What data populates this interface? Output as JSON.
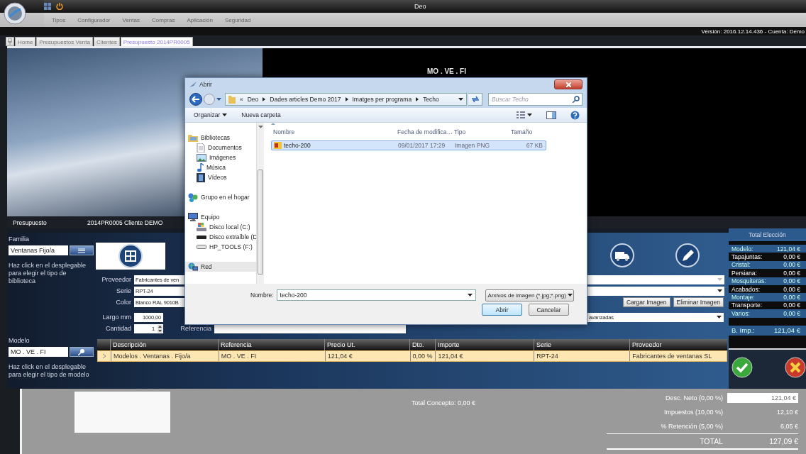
{
  "window": {
    "title": "Deo"
  },
  "menu": [
    "Tipos",
    "Configurador",
    "Ventas",
    "Compras",
    "Aplicación",
    "Seguridad"
  ],
  "version": "Versión: 2016.12.14.436 - Cuenta: Demo",
  "tabs": [
    {
      "label": "Home",
      "selected": false
    },
    {
      "label": "Presupuestos Venta",
      "selected": false
    },
    {
      "label": "Clientes",
      "selected": false
    },
    {
      "label": "Presupuesto 2014PR0005",
      "selected": true
    }
  ],
  "preview": {
    "model_code": "MO . VE . FI"
  },
  "budget": {
    "label": "Presupuesto",
    "value": "2014PR0005 Cliente DEMO"
  },
  "family": {
    "label": "Familia",
    "value": "Ventanas Fijo/a",
    "hint": "Haz click en el desplegable para elegir el tipo de biblioteca"
  },
  "model": {
    "label": "Modelo",
    "value": "MO . VE . FI",
    "hint": "Haz click en el desplegable para elegir el tipo de modelo"
  },
  "form": {
    "supplier": {
      "label": "Proveedor",
      "value": "Fabricantes de ven"
    },
    "series": {
      "label": "Serie",
      "value": "RPT-24"
    },
    "color": {
      "label": "Color",
      "value": "Blanco RAL 9010B"
    },
    "length": {
      "label": "Largo mm",
      "value": "1000,00"
    },
    "quantity": {
      "label": "Cantidad",
      "value": "1"
    },
    "reference": {
      "label": "Referencia"
    }
  },
  "image_buttons": [
    "Cargar Imagen",
    "Eliminar Imagen"
  ],
  "options_dropdown": {
    "value": "avanzadas"
  },
  "table": {
    "columns": [
      "Descripción",
      "Referencia",
      "Precio Ut.",
      "Dto.",
      "Importe",
      "Serie",
      "Proveedor"
    ],
    "rows": [
      {
        "selected": true,
        "cells": [
          "Modelos . Ventanas . Fijo/a",
          "MO . VE . FI",
          "121,04 €",
          "0,00 %",
          "121,04 €",
          "RPT-24",
          "Fabricantes de ventanas SL"
        ]
      }
    ]
  },
  "totals": {
    "title": "Total Elección",
    "rows": [
      {
        "label": "Modelo:",
        "value": "121,04 €"
      },
      {
        "label": "Tapajuntas:",
        "value": "0,00 €"
      },
      {
        "label": "Cristal:",
        "value": "0,00 €"
      },
      {
        "label": "Persiana:",
        "value": "0,00 €"
      },
      {
        "label": "Mosquiteras:",
        "value": "0,00 €"
      },
      {
        "label": "Acabados:",
        "value": "0,00 €"
      },
      {
        "label": "Montaje:",
        "value": "0,00 €"
      },
      {
        "label": "Transporte:",
        "value": "0,00 €"
      },
      {
        "label": "Varios:",
        "value": "0,00 €"
      }
    ],
    "base": {
      "label": "B. Imp.:",
      "value": "121,04 €"
    }
  },
  "summary": {
    "concept": "Total Concepto: 0,00 €",
    "rows": [
      {
        "kind": "field",
        "label": "Desc. Neto (0,00 %)",
        "value": "121,04 €"
      },
      {
        "kind": "text",
        "label": "Impuestos (10,00 %)",
        "value": "12,10 €"
      },
      {
        "kind": "text",
        "label": "% Retención (5,00 %)",
        "value": "6,05 €"
      },
      {
        "kind": "total",
        "label": "TOTAL",
        "value": "127,09 €"
      }
    ]
  },
  "dialog": {
    "title": "Abrir",
    "overflow_mark": "«",
    "path": [
      "Deo",
      "Dades articles Demo 2017",
      "Imatges per programa",
      "Techo"
    ],
    "search": {
      "placeholder": "Buscar Techo"
    },
    "toolbar": [
      {
        "kind": "menu",
        "label": "Organizar"
      },
      {
        "kind": "button",
        "label": "Nueva carpeta"
      }
    ],
    "nav": [
      {
        "kind": "library",
        "label": "Bibliotecas",
        "selected": false,
        "children": [
          {
            "kind": "documents",
            "label": "Documentos",
            "selected": false
          },
          {
            "kind": "pictures",
            "label": "Imágenes",
            "selected": false
          },
          {
            "kind": "music",
            "label": "Música",
            "selected": false
          },
          {
            "kind": "videos",
            "label": "Vídeos",
            "selected": false
          }
        ]
      },
      {
        "kind": "homegroup",
        "label": "Grupo en el hogar",
        "selected": false
      },
      {
        "kind": "computer",
        "label": "Equipo",
        "selected": false,
        "children": [
          {
            "kind": "disk",
            "label": "Disco local (C:)",
            "selected": false
          },
          {
            "kind": "removable",
            "label": "Disco extraíble (D",
            "selected": false
          },
          {
            "kind": "drive",
            "label": "HP_TOOLS (F:)",
            "selected": false
          }
        ]
      },
      {
        "kind": "network",
        "label": "Red",
        "selected": true
      }
    ],
    "columns": [
      "Nombre",
      "Fecha de modifica…",
      "Tipo",
      "Tamaño"
    ],
    "files": [
      {
        "selected": true,
        "cells": [
          "techo-200",
          "09/01/2017 17:29",
          "Imagen PNG",
          "67 KB"
        ]
      }
    ],
    "filename": {
      "label": "Nombre:",
      "value": "techo-200"
    },
    "filter": "Arxivos de imagen (*.jpg;*.png)",
    "buttons": [
      "Abrir",
      "Cancelar"
    ]
  }
}
